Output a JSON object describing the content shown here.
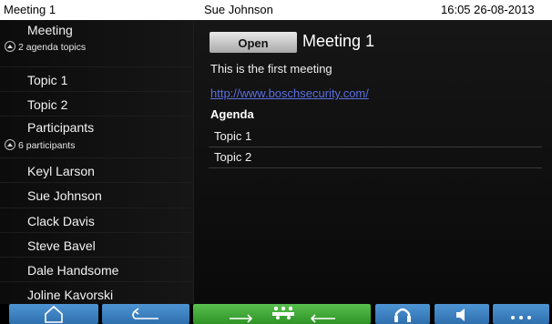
{
  "topbar": {
    "meeting": "Meeting 1",
    "user": "Sue Johnson",
    "datetime": "16:05 26-08-2013"
  },
  "sidebar": {
    "meeting_label": "Meeting",
    "meeting_sub": "2 agenda topics",
    "topics": [
      "Topic 1",
      "Topic 2"
    ],
    "participants_label": "Participants",
    "participants_sub": "6 participants",
    "participants": [
      "Keyl Larson",
      "Sue Johnson",
      "Clack Davis",
      "Steve Bavel",
      "Dale Handsome",
      "Joline Kavorski"
    ]
  },
  "content": {
    "open_label": "Open",
    "title": "Meeting 1",
    "description": "This is the first meeting",
    "link": "http://www.boschsecurity.com/",
    "agenda_heading": "Agenda",
    "agenda_items": [
      "Topic 1",
      "Topic 2"
    ]
  },
  "bottombar": {
    "icons": [
      "home-icon",
      "back-arrow-icon",
      "group-transfer-icon",
      "headphones-icon",
      "speaker-icon",
      "more-dots-icon"
    ],
    "colors": {
      "blue": "#3f83c4",
      "green": "#45ad3a"
    }
  }
}
